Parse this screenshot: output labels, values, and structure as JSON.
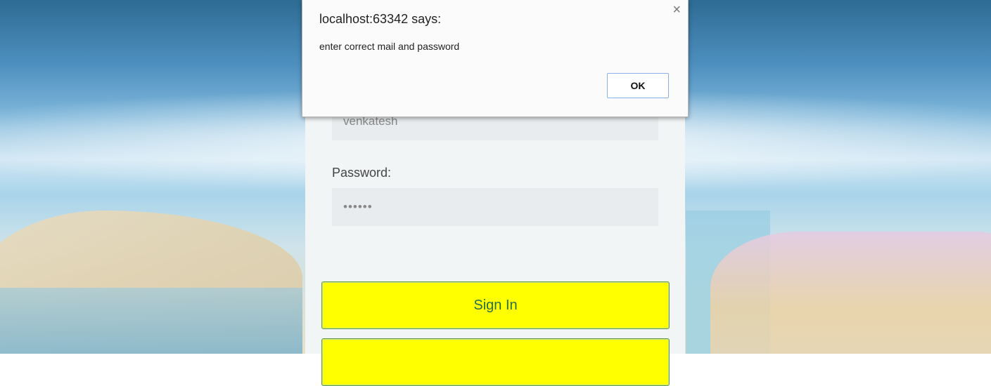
{
  "dialog": {
    "title": "localhost:63342 says:",
    "message": "enter correct mail and password",
    "ok_label": "OK",
    "close_glyph": "×"
  },
  "form": {
    "username_value": "venkatesh",
    "password_label": "Password:",
    "password_value": "••••••",
    "signin_label": "Sign In"
  },
  "colors": {
    "button_yellow": "#ffff00",
    "button_text": "#2b6e46",
    "panel_bg": "#f2f5f6",
    "dialog_button_border": "#8ab0e8"
  }
}
